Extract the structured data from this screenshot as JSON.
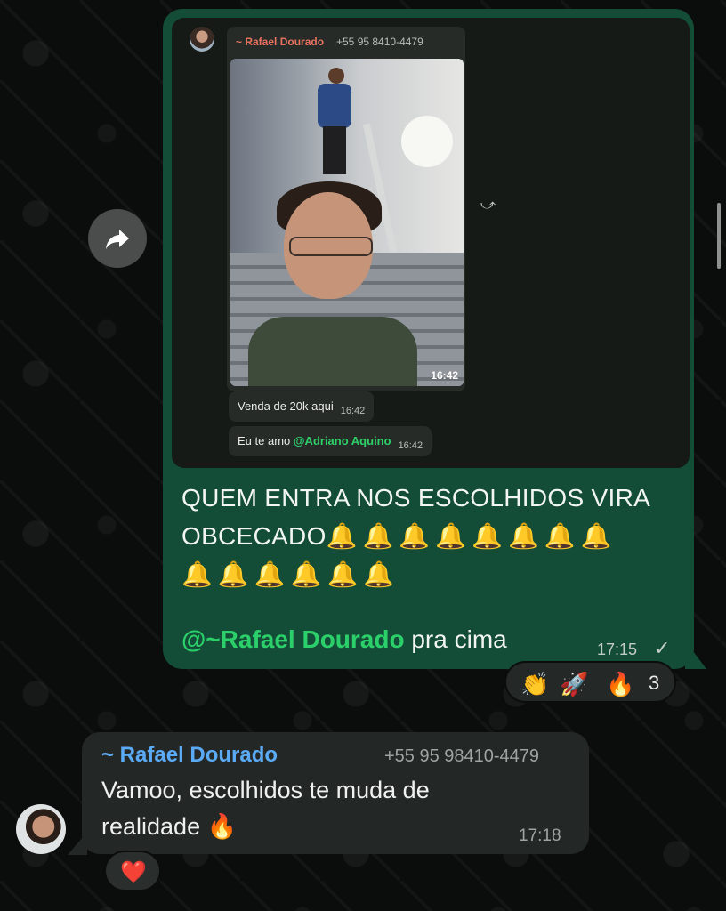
{
  "colors": {
    "background": "#0b0d0c",
    "outgoing_bubble": "#134d37",
    "incoming_bubble": "#232725",
    "mention_green": "#2bd06a",
    "sender_blue": "#5aaaf5",
    "mini_sender_orange": "#e8745f"
  },
  "forward_button": {
    "icon": "share-arrow-icon"
  },
  "outgoing": {
    "quoted_screenshot": {
      "sender_name": "~ Rafael Dourado",
      "sender_phone": "+55 95 8410-4479",
      "photo_time": "16:42",
      "messages": [
        {
          "text": "Venda de 20k aqui",
          "time": "16:42"
        },
        {
          "text_prefix": "Eu te amo ",
          "mention": "@Adriano Aquino",
          "time": "16:42"
        }
      ],
      "forward_icon": "forward-icon"
    },
    "text_line1": "QUEM ENTRA NOS ESCOLHIDOS VIRA",
    "text_line2": "OBCECADO",
    "bells_row1": "🔔🔔🔔🔔🔔🔔🔔🔔",
    "bells_row2": "🔔🔔🔔🔔🔔🔔",
    "mention": "@~Rafael Dourado",
    "mention_suffix": " pra cima",
    "time": "17:15",
    "status_icon": "✓",
    "reactions": {
      "emojis": [
        "👏",
        "🚀",
        "🔥"
      ],
      "count": "3"
    }
  },
  "incoming": {
    "sender_name": "~ Rafael Dourado",
    "sender_phone": "+55 95 98410-4479",
    "text_line1": "Vamoo, escolhidos te muda de",
    "text_line2": "realidade 🔥",
    "time": "17:18",
    "reaction": "❤️"
  }
}
